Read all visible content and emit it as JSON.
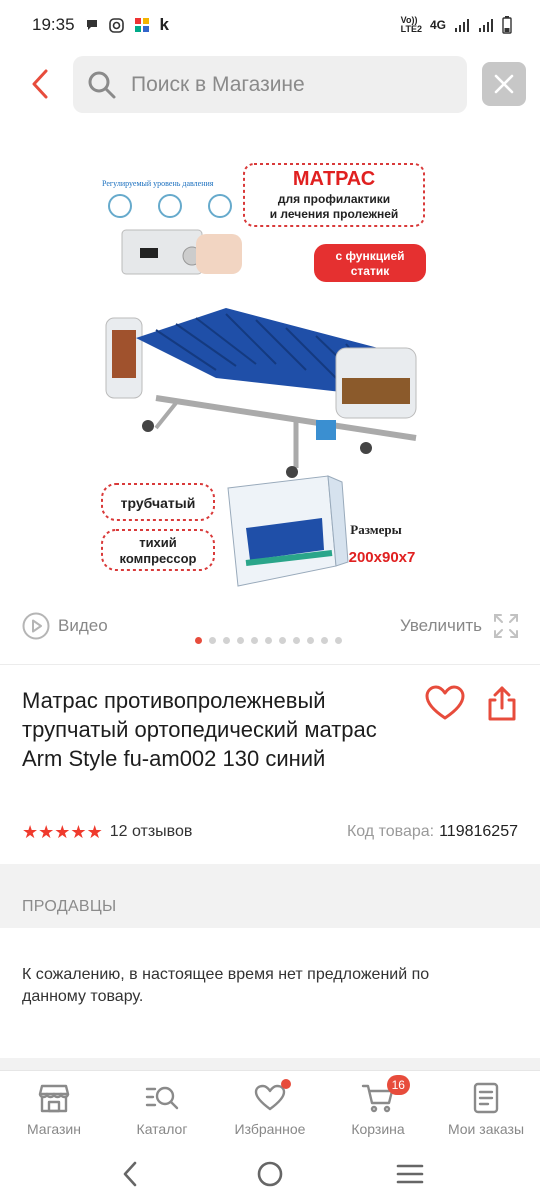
{
  "status_bar": {
    "time": "19:35",
    "k_label": "k",
    "network": "4G",
    "volte": "Vo))\nLTE2"
  },
  "search": {
    "placeholder": "Поиск в Магазине"
  },
  "image_overlay": {
    "headline": "МАТРАС",
    "subline1": "для профилактики",
    "subline2": "и лечения пролежней",
    "function_line1": "с функцией",
    "function_line2": "статик",
    "pressure_caption": "Регулируемый уровень давления",
    "tube_label": "трубчатый",
    "compressor_line1": "тихий",
    "compressor_line2": "компрессор",
    "sizes_label": "Размеры",
    "sizes_value": "200х90х7"
  },
  "gallery": {
    "video_label": "Видео",
    "zoom_label": "Увеличить",
    "dot_count": 11,
    "active_dot": 0
  },
  "product": {
    "title": "Матрас противопролежневый трупчатый ортопедический матрас Arm Style fu-am002 130 синий",
    "rating_stars": 5,
    "reviews": "12 отзывов",
    "code_label": "Код товара:",
    "code_value": "119816257"
  },
  "sellers": {
    "header": "ПРОДАВЦЫ",
    "empty_message": "К сожалению, в настоящее время нет предложений по данному товару."
  },
  "bottom_nav": {
    "items": [
      {
        "label": "Магазин",
        "icon": "store-icon"
      },
      {
        "label": "Каталог",
        "icon": "catalog-search-icon"
      },
      {
        "label": "Избранное",
        "icon": "heart-icon"
      },
      {
        "label": "Корзина",
        "icon": "cart-icon",
        "badge": "16"
      },
      {
        "label": "Мои заказы",
        "icon": "orders-icon"
      }
    ]
  },
  "colors": {
    "accent": "#e74c3c",
    "muted": "#888888"
  }
}
